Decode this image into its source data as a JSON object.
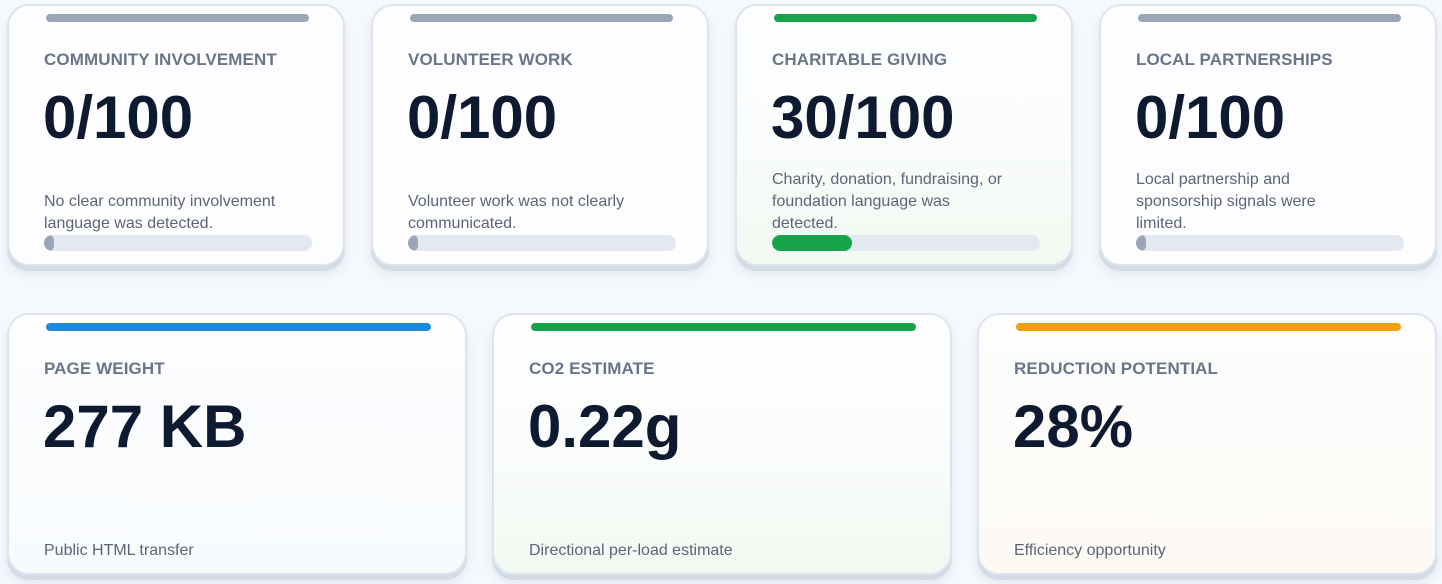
{
  "score_cards": [
    {
      "label": "COMMUNITY INVOLVEMENT",
      "value": "0/100",
      "description": "No clear community involvement language was detected.",
      "score": 0,
      "accent_color": "#9aa6b8",
      "fill_color": "#9aa6b8"
    },
    {
      "label": "VOLUNTEER WORK",
      "value": "0/100",
      "description": "Volunteer work was not clearly communicated.",
      "score": 0,
      "accent_color": "#9aa6b8",
      "fill_color": "#9aa6b8"
    },
    {
      "label": "CHARITABLE GIVING",
      "value": "30/100",
      "description": "Charity, donation, fundraising, or foundation language was detected.",
      "score": 30,
      "accent_color": "#16a34a",
      "fill_color": "#16a34a"
    },
    {
      "label": "LOCAL PARTNERSHIPS",
      "value": "0/100",
      "description": "Local partnership and sponsorship signals were limited.",
      "score": 0,
      "accent_color": "#9aa6b8",
      "fill_color": "#9aa6b8"
    }
  ],
  "metric_cards": [
    {
      "label": "PAGE WEIGHT",
      "value": "277 KB",
      "description": "Public HTML transfer",
      "accent_color": "#1e8ad8"
    },
    {
      "label": "CO2 ESTIMATE",
      "value": "0.22g",
      "description": "Directional per-load estimate",
      "accent_color": "#16a34a"
    },
    {
      "label": "REDUCTION POTENTIAL",
      "value": "28%",
      "description": "Efficiency opportunity",
      "accent_color": "#f59e0b"
    }
  ]
}
